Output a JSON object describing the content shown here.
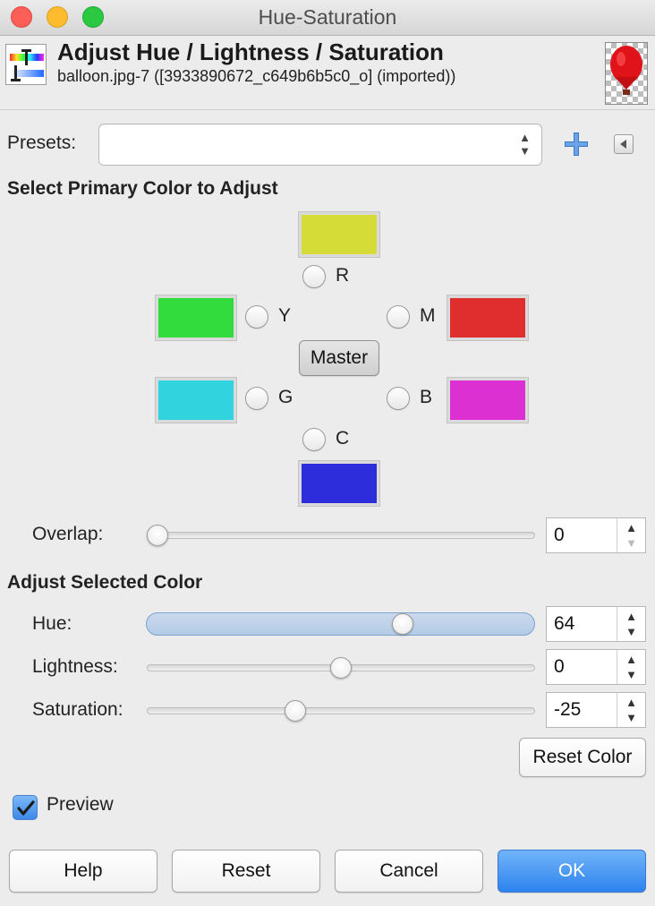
{
  "window": {
    "title": "Hue-Saturation"
  },
  "header": {
    "title": "Adjust Hue / Lightness / Saturation",
    "subtitle": "balloon.jpg-7 ([3933890672_c649b6b5c0_o] (imported))"
  },
  "presets": {
    "label": "Presets:",
    "value": ""
  },
  "primary": {
    "heading": "Select Primary Color to Adjust",
    "r": {
      "label": "R",
      "color": "#d5dc38"
    },
    "y": {
      "label": "Y",
      "color": "#33dc3d"
    },
    "m": {
      "label": "M",
      "color": "#e02d2d"
    },
    "g": {
      "label": "G",
      "color": "#30d3de"
    },
    "b": {
      "label": "B",
      "color": "#dc30d3"
    },
    "c": {
      "label": "C",
      "color": "#2d2ddc"
    },
    "master_label": "Master"
  },
  "overlap": {
    "label": "Overlap:",
    "value": "0",
    "fraction": 0.0
  },
  "adjust": {
    "heading": "Adjust Selected Color",
    "hue": {
      "label": "Hue:",
      "value": "64",
      "fraction": 0.67
    },
    "lightness": {
      "label": "Lightness:",
      "value": "0",
      "fraction": 0.5
    },
    "saturation": {
      "label": "Saturation:",
      "value": "-25",
      "fraction": 0.375
    },
    "reset_color_label": "Reset Color"
  },
  "preview": {
    "label": "Preview",
    "checked": true
  },
  "buttons": {
    "help": "Help",
    "reset": "Reset",
    "cancel": "Cancel",
    "ok": "OK"
  }
}
